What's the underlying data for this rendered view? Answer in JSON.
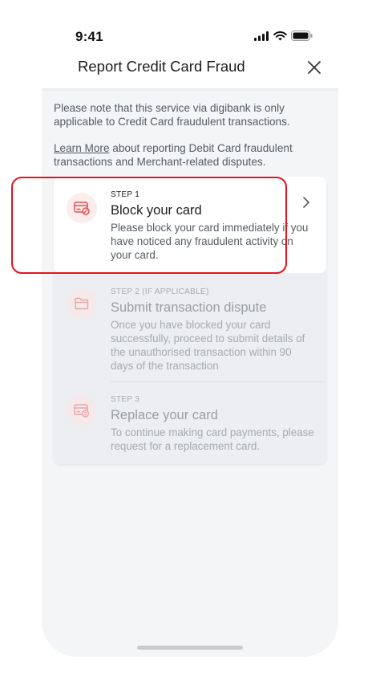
{
  "status_bar": {
    "time": "9:41",
    "icons": [
      "cellular-signal-icon",
      "wifi-icon",
      "battery-icon"
    ]
  },
  "header": {
    "title": "Report Credit Card Fraud",
    "close_icon": "close-icon"
  },
  "intro": {
    "text": "Please note that this service via digibank is only applicable to Credit Card fraudulent transactions.",
    "learn_more_link": "Learn More",
    "learn_more_rest": " about reporting Debit Card fraudulent transactions and Merchant-related disputes."
  },
  "steps": [
    {
      "eyebrow": "STEP 1",
      "title": "Block your card",
      "description": "Please block your card immediately if you have noticed any fraudulent activity on your card.",
      "icon": "card-block-icon",
      "enabled": true
    },
    {
      "eyebrow": "STEP 2 (IF APPLICABLE)",
      "title": "Submit transaction dispute",
      "description": "Once you have blocked your card successfully, proceed to submit details of the unauthorised transaction within 90 days of the transaction",
      "icon": "folder-icon",
      "enabled": false
    },
    {
      "eyebrow": "STEP 3",
      "title": "Replace your card",
      "description": "To continue making card payments, please request for a replacement card.",
      "icon": "card-replace-icon",
      "enabled": false
    }
  ],
  "colors": {
    "accent_red": "#e3141c",
    "icon_red": "#d9534f",
    "icon_bg": "#fdecec",
    "background": "#f4f5f7"
  }
}
